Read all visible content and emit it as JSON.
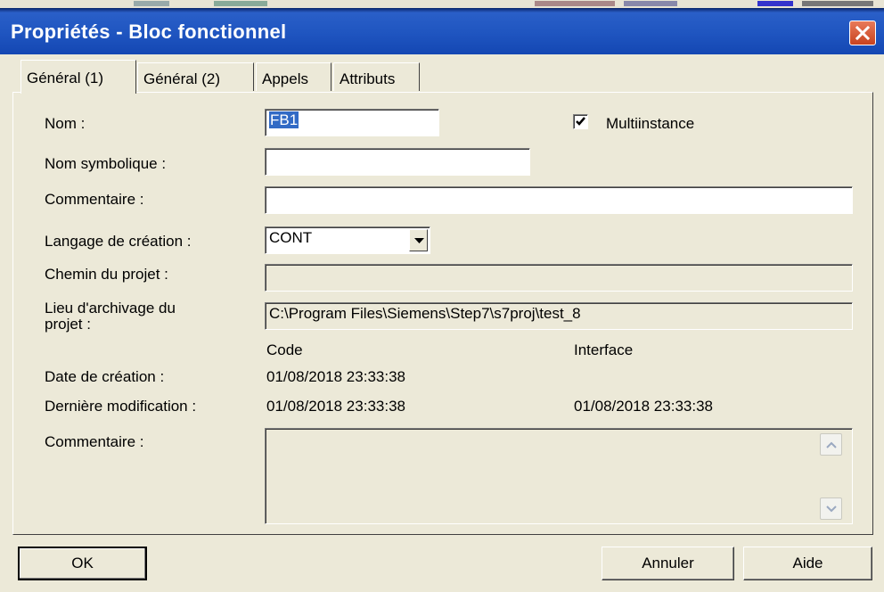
{
  "window": {
    "title": "Propriétés - Bloc fonctionnel"
  },
  "tabs": [
    {
      "label": "Général (1)",
      "active": true
    },
    {
      "label": "Général  (2)",
      "active": false
    },
    {
      "label": "Appels",
      "active": false
    },
    {
      "label": "Attributs",
      "active": false
    }
  ],
  "form": {
    "nom_label": "Nom :",
    "nom_value": "FB1",
    "multiinstance_label": "Multiinstance",
    "multiinstance_checked": true,
    "nom_symbolique_label": "Nom symbolique :",
    "nom_symbolique_value": "",
    "commentaire_label": "Commentaire :",
    "commentaire_value": "",
    "langage_label": "Langage de création :",
    "langage_value": "CONT",
    "chemin_label": "Chemin du projet :",
    "chemin_value": "",
    "lieu_label_line1": "Lieu  d'archivage du",
    "lieu_label_line2": "projet :",
    "lieu_value": "C:\\Program Files\\Siemens\\Step7\\s7proj\\test_8",
    "col_code": "Code",
    "col_interface": "Interface",
    "date_creation_label": "Date de création :",
    "date_creation_code": "01/08/2018 23:33:38",
    "derniere_modif_label": "Dernière modification :",
    "derniere_modif_code": "01/08/2018 23:33:38",
    "derniere_modif_interface": "01/08/2018 23:33:38",
    "commentaire2_label": "Commentaire :",
    "commentaire2_value": ""
  },
  "buttons": {
    "ok": "OK",
    "annuler": "Annuler",
    "aide": "Aide"
  },
  "icons": {
    "close": "close-icon",
    "checkmark": "checkmark-icon",
    "dropdown": "chevron-down-icon",
    "scroll_up": "chevron-up-icon",
    "scroll_down": "chevron-down-icon"
  },
  "colors": {
    "titlebar": "#1f55c0",
    "close_button": "#d9532f",
    "window_bg": "#ece9d8",
    "selection": "#316ac5"
  }
}
